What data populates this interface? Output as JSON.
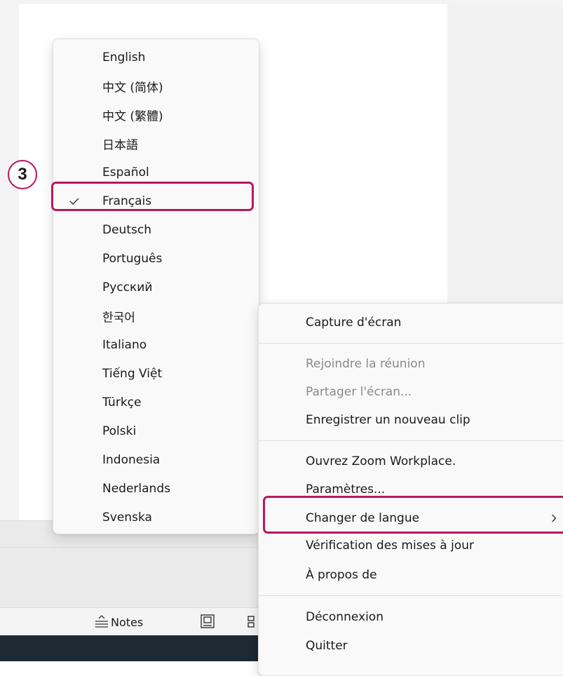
{
  "language_menu": {
    "items": [
      {
        "label": "English"
      },
      {
        "label": "中文 (简体)"
      },
      {
        "label": "中文 (繁體)"
      },
      {
        "label": "日本語"
      },
      {
        "label": "Español"
      },
      {
        "label": "Français",
        "checked": true
      },
      {
        "label": "Deutsch"
      },
      {
        "label": "Português"
      },
      {
        "label": "Русский"
      },
      {
        "label": "한국어"
      },
      {
        "label": "Italiano"
      },
      {
        "label": "Tiếng Việt"
      },
      {
        "label": "Türkçe"
      },
      {
        "label": "Polski"
      },
      {
        "label": "Indonesia"
      },
      {
        "label": "Nederlands"
      },
      {
        "label": "Svenska"
      }
    ],
    "check_icon": "checkmark-icon"
  },
  "context_menu": {
    "items": [
      {
        "label": "Capture d'écran",
        "disabled": false
      },
      {
        "label": "Rejoindre la réunion",
        "disabled": true
      },
      {
        "label": "Partager l'écran...",
        "disabled": true
      },
      {
        "label": "Enregistrer un nouveau clip",
        "disabled": false
      },
      {
        "label": "Ouvrez Zoom Workplace.",
        "disabled": false
      },
      {
        "label": "Paramètres...",
        "disabled": false
      },
      {
        "label": "Changer de langue",
        "disabled": false,
        "submenu": true
      },
      {
        "label": "Vérification des mises à jour",
        "disabled": false
      },
      {
        "label": "À propos de",
        "disabled": false
      },
      {
        "label": "Déconnexion",
        "disabled": false
      },
      {
        "label": "Quitter",
        "disabled": false
      }
    ]
  },
  "status_bar": {
    "notes_label": "Notes"
  },
  "annotation": {
    "step_number": "3",
    "highlight_color": "#b8185e"
  },
  "colors": {
    "menu_background": "#f9f9f9",
    "disabled_text": "#8a8a8a",
    "taskbar": "#1d2a33",
    "accent_blue": "#3577e0"
  }
}
